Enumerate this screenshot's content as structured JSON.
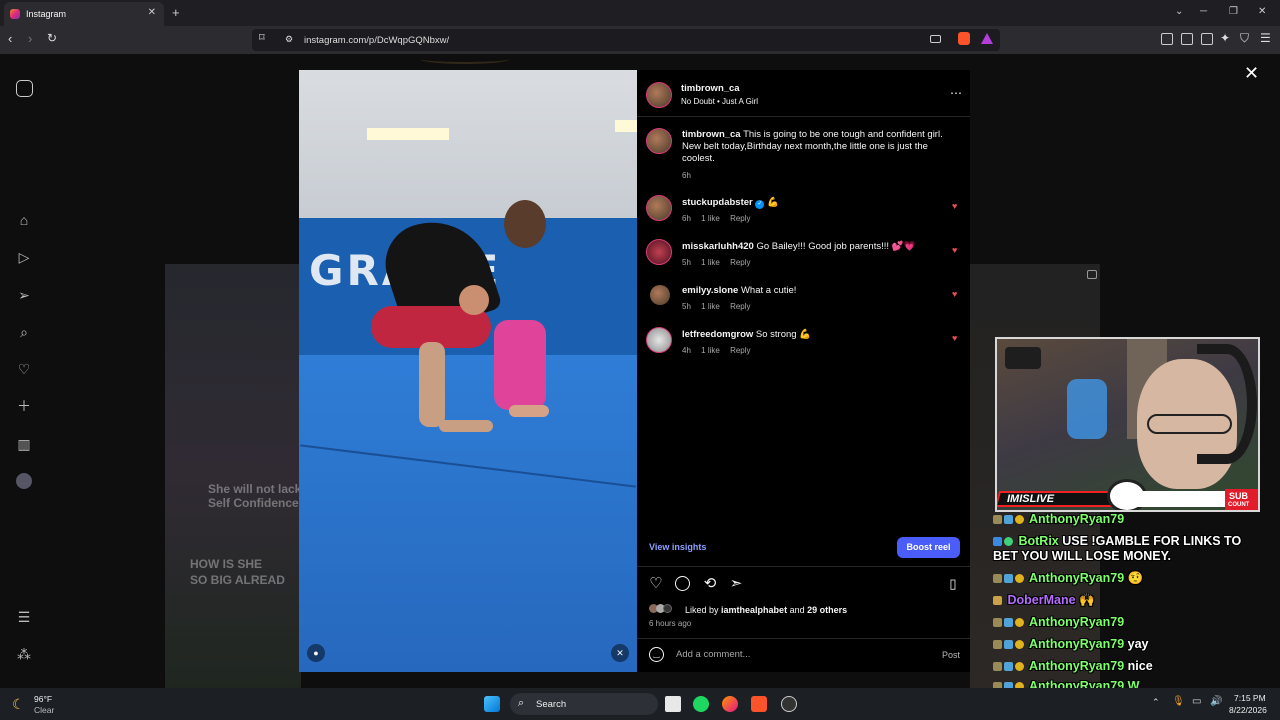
{
  "browser": {
    "tab_title": "Instagram",
    "url": "instagram.com/p/DcWqpGQNbxw/"
  },
  "post": {
    "author": "timbrown_ca",
    "audio": "No Doubt • Just A Girl",
    "caption_user": "timbrown_ca",
    "caption_text": "This is going to be one tough and confident girl. New belt today,Birthday next month,the little one is just the coolest.",
    "caption_time": "6h",
    "comments": [
      {
        "user": "stuckupdabster",
        "text": "💪",
        "time": "6h",
        "likes": "1 like",
        "reply": "Reply"
      },
      {
        "user": "misskarluhh420",
        "text": "Go Bailey!!! Good job parents!!! 💕💗",
        "time": "5h",
        "likes": "1 like",
        "reply": "Reply"
      },
      {
        "user": "emilyy.slone",
        "text": "What a cutie!",
        "time": "5h",
        "likes": "1 like",
        "reply": "Reply"
      },
      {
        "user": "letfreedomgrow",
        "text": "So strong 💪",
        "time": "4h",
        "likes": "1 like",
        "reply": "Reply"
      }
    ],
    "view_insights": "View insights",
    "boost": "Boost reel",
    "liked_prefix": "Liked by",
    "liked_user": "iamthealphabet",
    "liked_and": "and",
    "liked_others": "29 others",
    "post_time": "6 hours ago",
    "comment_placeholder": "Add a comment...",
    "post_button": "Post"
  },
  "media": {
    "wall_text": "GRACIE"
  },
  "background": {
    "left_text_1": "She will not lack",
    "left_text_2": "Self Confidence",
    "left_text_3": "HOW IS SHE",
    "left_text_4": "SO BIG ALREAD"
  },
  "stream": {
    "banner": "IMISLIVE",
    "sub_count": "SUB",
    "sub_count_2": "COUNT",
    "chat": [
      {
        "user": "AnthonyRyan79",
        "msg": "",
        "color": "#7dff6a"
      },
      {
        "user": "BotRix",
        "msg": "USE !GAMBLE FOR LINKS TO BET YOU WILL LOSE MONEY.",
        "color": "#7dff6a"
      },
      {
        "user": "AnthonyRyan79",
        "msg": "🤨",
        "color": "#7dff6a"
      },
      {
        "user": "DoberMane",
        "msg": "🙌",
        "color": "#b56cff"
      },
      {
        "user": "AnthonyRyan79",
        "msg": "",
        "color": "#7dff6a"
      },
      {
        "user": "AnthonyRyan79",
        "msg": "yay",
        "color": "#7dff6a"
      },
      {
        "user": "AnthonyRyan79",
        "msg": "nice",
        "color": "#7dff6a"
      },
      {
        "user": "AnthonyRyan79",
        "msg": "W",
        "color": "#7dff6a"
      }
    ]
  },
  "taskbar": {
    "weather_temp": "96°F",
    "weather_desc": "Clear",
    "search": "Search",
    "time": "7:15 PM",
    "date": "8/22/2026"
  },
  "colors": {
    "accent": "#4a5df9",
    "like": "#ed4956"
  }
}
